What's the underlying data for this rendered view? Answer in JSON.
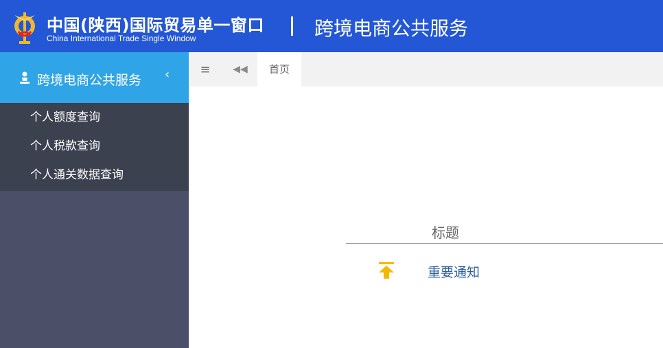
{
  "header": {
    "brand_cn": "中国(陕西)国际贸易单一窗口",
    "brand_en": "China International Trade Single Window",
    "divider": "|",
    "service_title": "跨境电商公共服务",
    "bg_color": "#2457d6"
  },
  "sidebar": {
    "title": "跨境电商公共服务",
    "collapse_icon": "chevron-left-icon",
    "items": [
      {
        "label": "个人额度查询"
      },
      {
        "label": "个人税款查询"
      },
      {
        "label": "个人通关数据查询"
      }
    ],
    "head_color": "#2fa4e7"
  },
  "tabbar": {
    "menu_icon": "≡",
    "back_icon": "◀◀",
    "home_tab": "首页"
  },
  "content": {
    "column_header": "标题",
    "rows": [
      {
        "icon": "top-arrow-icon",
        "title": "重要通知"
      }
    ]
  }
}
